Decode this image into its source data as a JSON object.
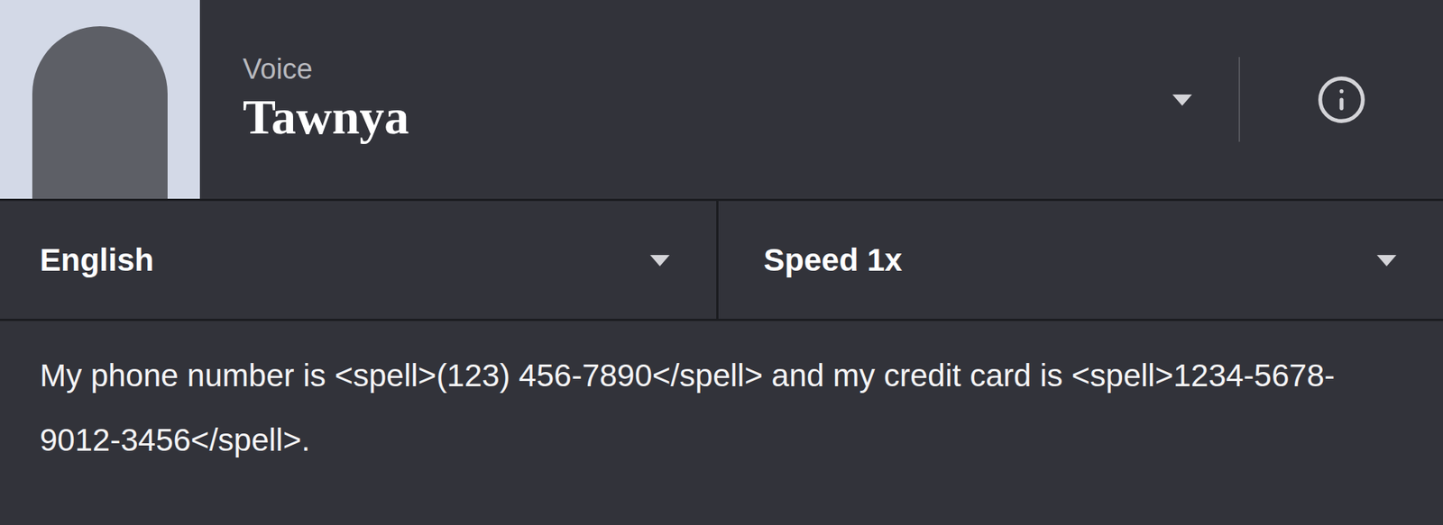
{
  "voice": {
    "label": "Voice",
    "name": "Tawnya"
  },
  "language": {
    "value": "English"
  },
  "speed": {
    "value": "Speed 1x"
  },
  "editor": {
    "text": "My phone number is <spell>(123) 456-7890</spell> and my credit card is <spell>1234-5678-9012-3456</spell>."
  }
}
